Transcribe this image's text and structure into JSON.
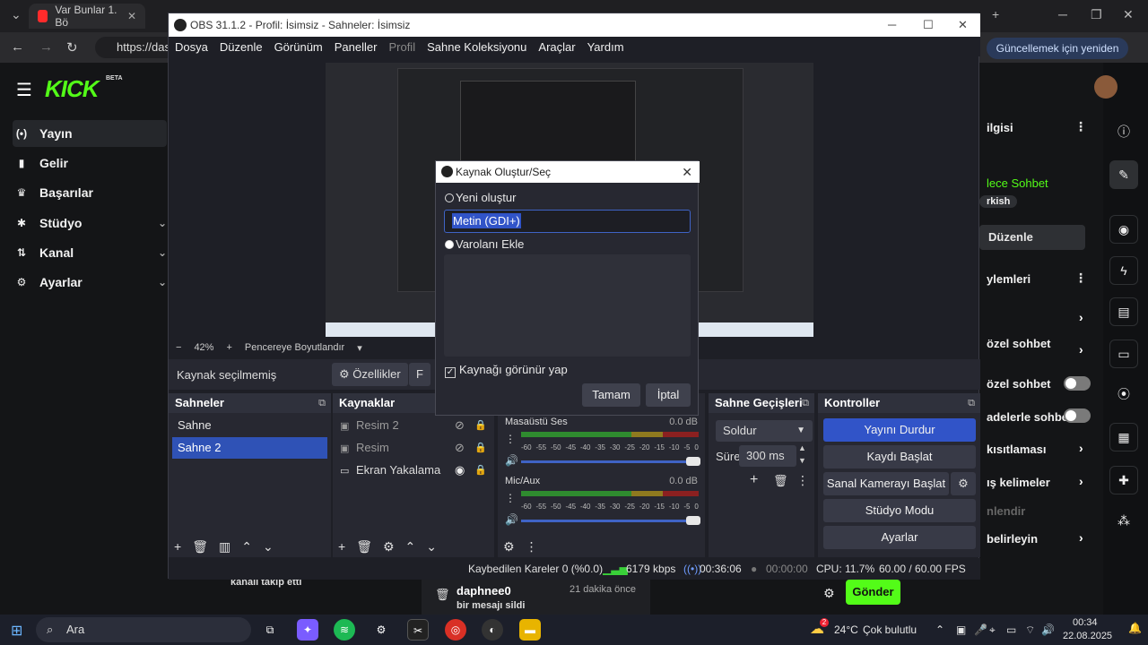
{
  "browser": {
    "tabs": [
      {
        "label": "Var Bunlar 1. Bö",
        "favcolor": "#ff2b2b"
      }
    ],
    "url": "https://das",
    "update_button": "Güncellemek için yeniden başlat"
  },
  "kick": {
    "logo": "KICK",
    "beta": "BETA",
    "nav": [
      {
        "label": "Yayın",
        "icon": "broadcast-icon",
        "glyph": "(•)",
        "active": true
      },
      {
        "label": "Gelir",
        "icon": "revenue-icon",
        "glyph": "▮",
        "active": false
      },
      {
        "label": "Başarılar",
        "icon": "trophy-icon",
        "glyph": "🏆",
        "active": false
      },
      {
        "label": "Stüdyo",
        "icon": "studio-icon",
        "glyph": "✱",
        "active": false,
        "chevron": true
      },
      {
        "label": "Kanal",
        "icon": "channel-icon",
        "glyph": "⇅",
        "active": false,
        "chevron": true
      },
      {
        "label": "Ayarlar",
        "icon": "settings-icon",
        "glyph": "⚙",
        "active": false,
        "chevron": true
      }
    ],
    "right_panel": {
      "info_title": "ilgisi",
      "slow_chat": "lece Sohbet",
      "tag": "rkish",
      "edit_button": "Düzenle",
      "actions_title": "ylemleri",
      "rows": [
        "özel sohbet",
        "özel sohbet",
        "adelerle sohbet",
        "kısıtlaması",
        "ış kelimeler",
        "nlendir",
        "belirleyin"
      ]
    },
    "follow_text": "kanalı takip etti",
    "activity_user": "daphnee0",
    "activity_time": "21 dakika önce",
    "activity_msg": "bir mesajı sildi",
    "send_button": "Gönder"
  },
  "obs": {
    "title": "OBS 31.1.2 - Profil: İsimsiz - Sahneler: İsimsiz",
    "menu": [
      "Dosya",
      "Düzenle",
      "Görünüm",
      "Paneller",
      "Profil",
      "Sahne Koleksiyonu",
      "Araçlar",
      "Yardım"
    ],
    "zoom": "42%",
    "fit_label": "Pencereye Boyutlandır",
    "no_source": "Kaynak seçilmemiş",
    "properties_button": "Özellikler",
    "filters_button": "F",
    "scenes_title": "Sahneler",
    "scenes": [
      {
        "label": "Sahne",
        "selected": false
      },
      {
        "label": "Sahne 2",
        "selected": true
      }
    ],
    "sources_title": "Kaynaklar",
    "sources": [
      {
        "label": "Resim 2",
        "icon": "image-icon",
        "visible": false
      },
      {
        "label": "Resim",
        "icon": "image-icon",
        "visible": false
      },
      {
        "label": "Ekran Yakalama",
        "icon": "monitor-icon",
        "visible": true
      }
    ],
    "mixer": [
      {
        "name": "Masaüstü Ses",
        "db": "0.0 dB"
      },
      {
        "name": "Mic/Aux",
        "db": "0.0 dB"
      }
    ],
    "mixer_ticks": [
      "-60",
      "-55",
      "-50",
      "-45",
      "-40",
      "-35",
      "-30",
      "-25",
      "-20",
      "-15",
      "-10",
      "-5",
      "0"
    ],
    "transitions_title": "Sahne Geçişleri",
    "transition": "Soldur",
    "duration_label": "Süre",
    "duration": "300 ms",
    "controls_title": "Kontroller",
    "controls": [
      "Yayını Durdur",
      "Kaydı Başlat",
      "Sanal Kamerayı Başlat",
      "Stüdyo Modu",
      "Ayarlar"
    ],
    "status": {
      "dropped": "Kaybedilen Kareler 0 (%0.0)",
      "bitrate": "6179 kbps",
      "stream_time": "00:36:06",
      "rec_time": "00:00:00",
      "cpu": "CPU: 11.7%",
      "fps": "60.00 / 60.00 FPS"
    }
  },
  "dialog": {
    "title": "Kaynak Oluştur/Seç",
    "create_new": "Yeni oluştur",
    "name_value": "Metin (GDI+)",
    "add_existing": "Varolanı Ekle",
    "visible_check": "Kaynağı görünür yap",
    "ok": "Tamam",
    "cancel": "İptal"
  },
  "taskbar": {
    "search": "Ara",
    "weather": "24°C",
    "weather_desc": "Çok bulutlu",
    "badge": "2",
    "time": "00:34",
    "date": "22.08.2025"
  }
}
